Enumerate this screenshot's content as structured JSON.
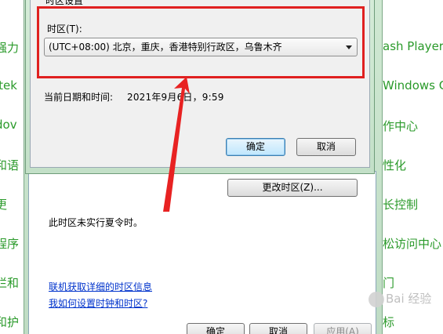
{
  "background_panel": {
    "left_items": [
      "强力",
      "ltek",
      "dov",
      "和语",
      "更",
      "程序",
      "栏和",
      "和护"
    ],
    "right_items": [
      "ash Player",
      "Windows Ca",
      "作中心",
      "性化",
      "长控制",
      "松访问中心",
      "门",
      "标"
    ]
  },
  "dialog": {
    "header_fragment": "时区设置",
    "timezone_label": "时区(T):",
    "timezone_value": "(UTC+08:00) 北京，重庆，香港特别行政区，乌鲁木齐",
    "current_datetime_label": "当前日期和时间:",
    "current_datetime_value": "2021年9月6日，9:59",
    "ok_label": "确定",
    "cancel_label": "取消"
  },
  "parent": {
    "change_timezone_label": "更改时区(Z)...",
    "dst_info": "此时区未实行夏令时。",
    "link_online_info": "联机获取详细的时区信息",
    "link_how_to_set": "我如何设置时钟和时区?",
    "ok_label": "确定",
    "cancel_label": "取消",
    "apply_label": "应用(A)"
  },
  "watermark": {
    "text": "Bai 经验"
  },
  "colors": {
    "highlight_red": "#e02020",
    "link_blue": "#0033cc",
    "panel_green": "#2a9a2a"
  }
}
